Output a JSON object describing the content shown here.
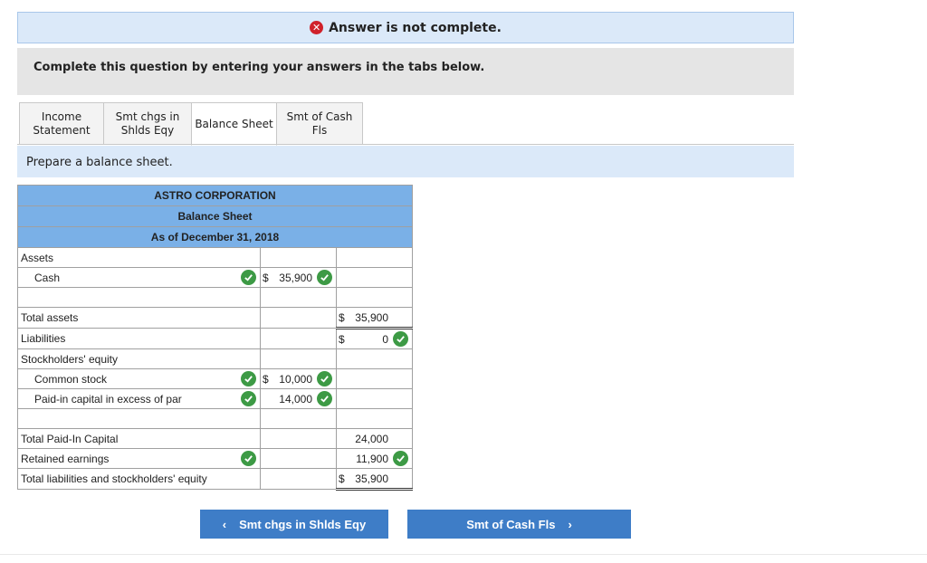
{
  "banner": {
    "text": "Answer is not complete."
  },
  "instruction": "Complete this question by entering your answers in the tabs below.",
  "tabs": [
    {
      "line1": "Income",
      "line2": "Statement"
    },
    {
      "line1": "Smt chgs in",
      "line2": "Shlds Eqy"
    },
    {
      "line1": "Balance Sheet",
      "line2": ""
    },
    {
      "line1": "Smt of Cash",
      "line2": "Fls"
    }
  ],
  "prompt": "Prepare a balance sheet.",
  "sheet": {
    "company": "ASTRO CORPORATION",
    "title": "Balance Sheet",
    "date": "As of December 31, 2018",
    "assets_label": "Assets",
    "cash_label": "Cash",
    "cash_dollar": "$",
    "cash_value": "35,900",
    "total_assets_label": "Total assets",
    "total_assets_dollar": "$",
    "total_assets_value": "35,900",
    "liabilities_label": "Liabilities",
    "liabilities_dollar": "$",
    "liabilities_value": "0",
    "se_label": "Stockholders' equity",
    "common_label": "Common stock",
    "common_dollar": "$",
    "common_value": "10,000",
    "apic_label": "Paid-in capital in excess of par",
    "apic_value": "14,000",
    "total_pic_label": "Total Paid-In Capital",
    "total_pic_value": "24,000",
    "re_label": "Retained earnings",
    "re_value": "11,900",
    "total_lse_label": "Total liabilities and stockholders' equity",
    "total_lse_dollar": "$",
    "total_lse_value": "35,900"
  },
  "nav": {
    "prev_label": "Smt chgs in Shlds Eqy",
    "next_label": "Smt of Cash Fls"
  },
  "colors": {
    "header": "#7ab0e7",
    "button": "#3e7dc7",
    "check": "#3d9a45",
    "error": "#d0212b"
  }
}
